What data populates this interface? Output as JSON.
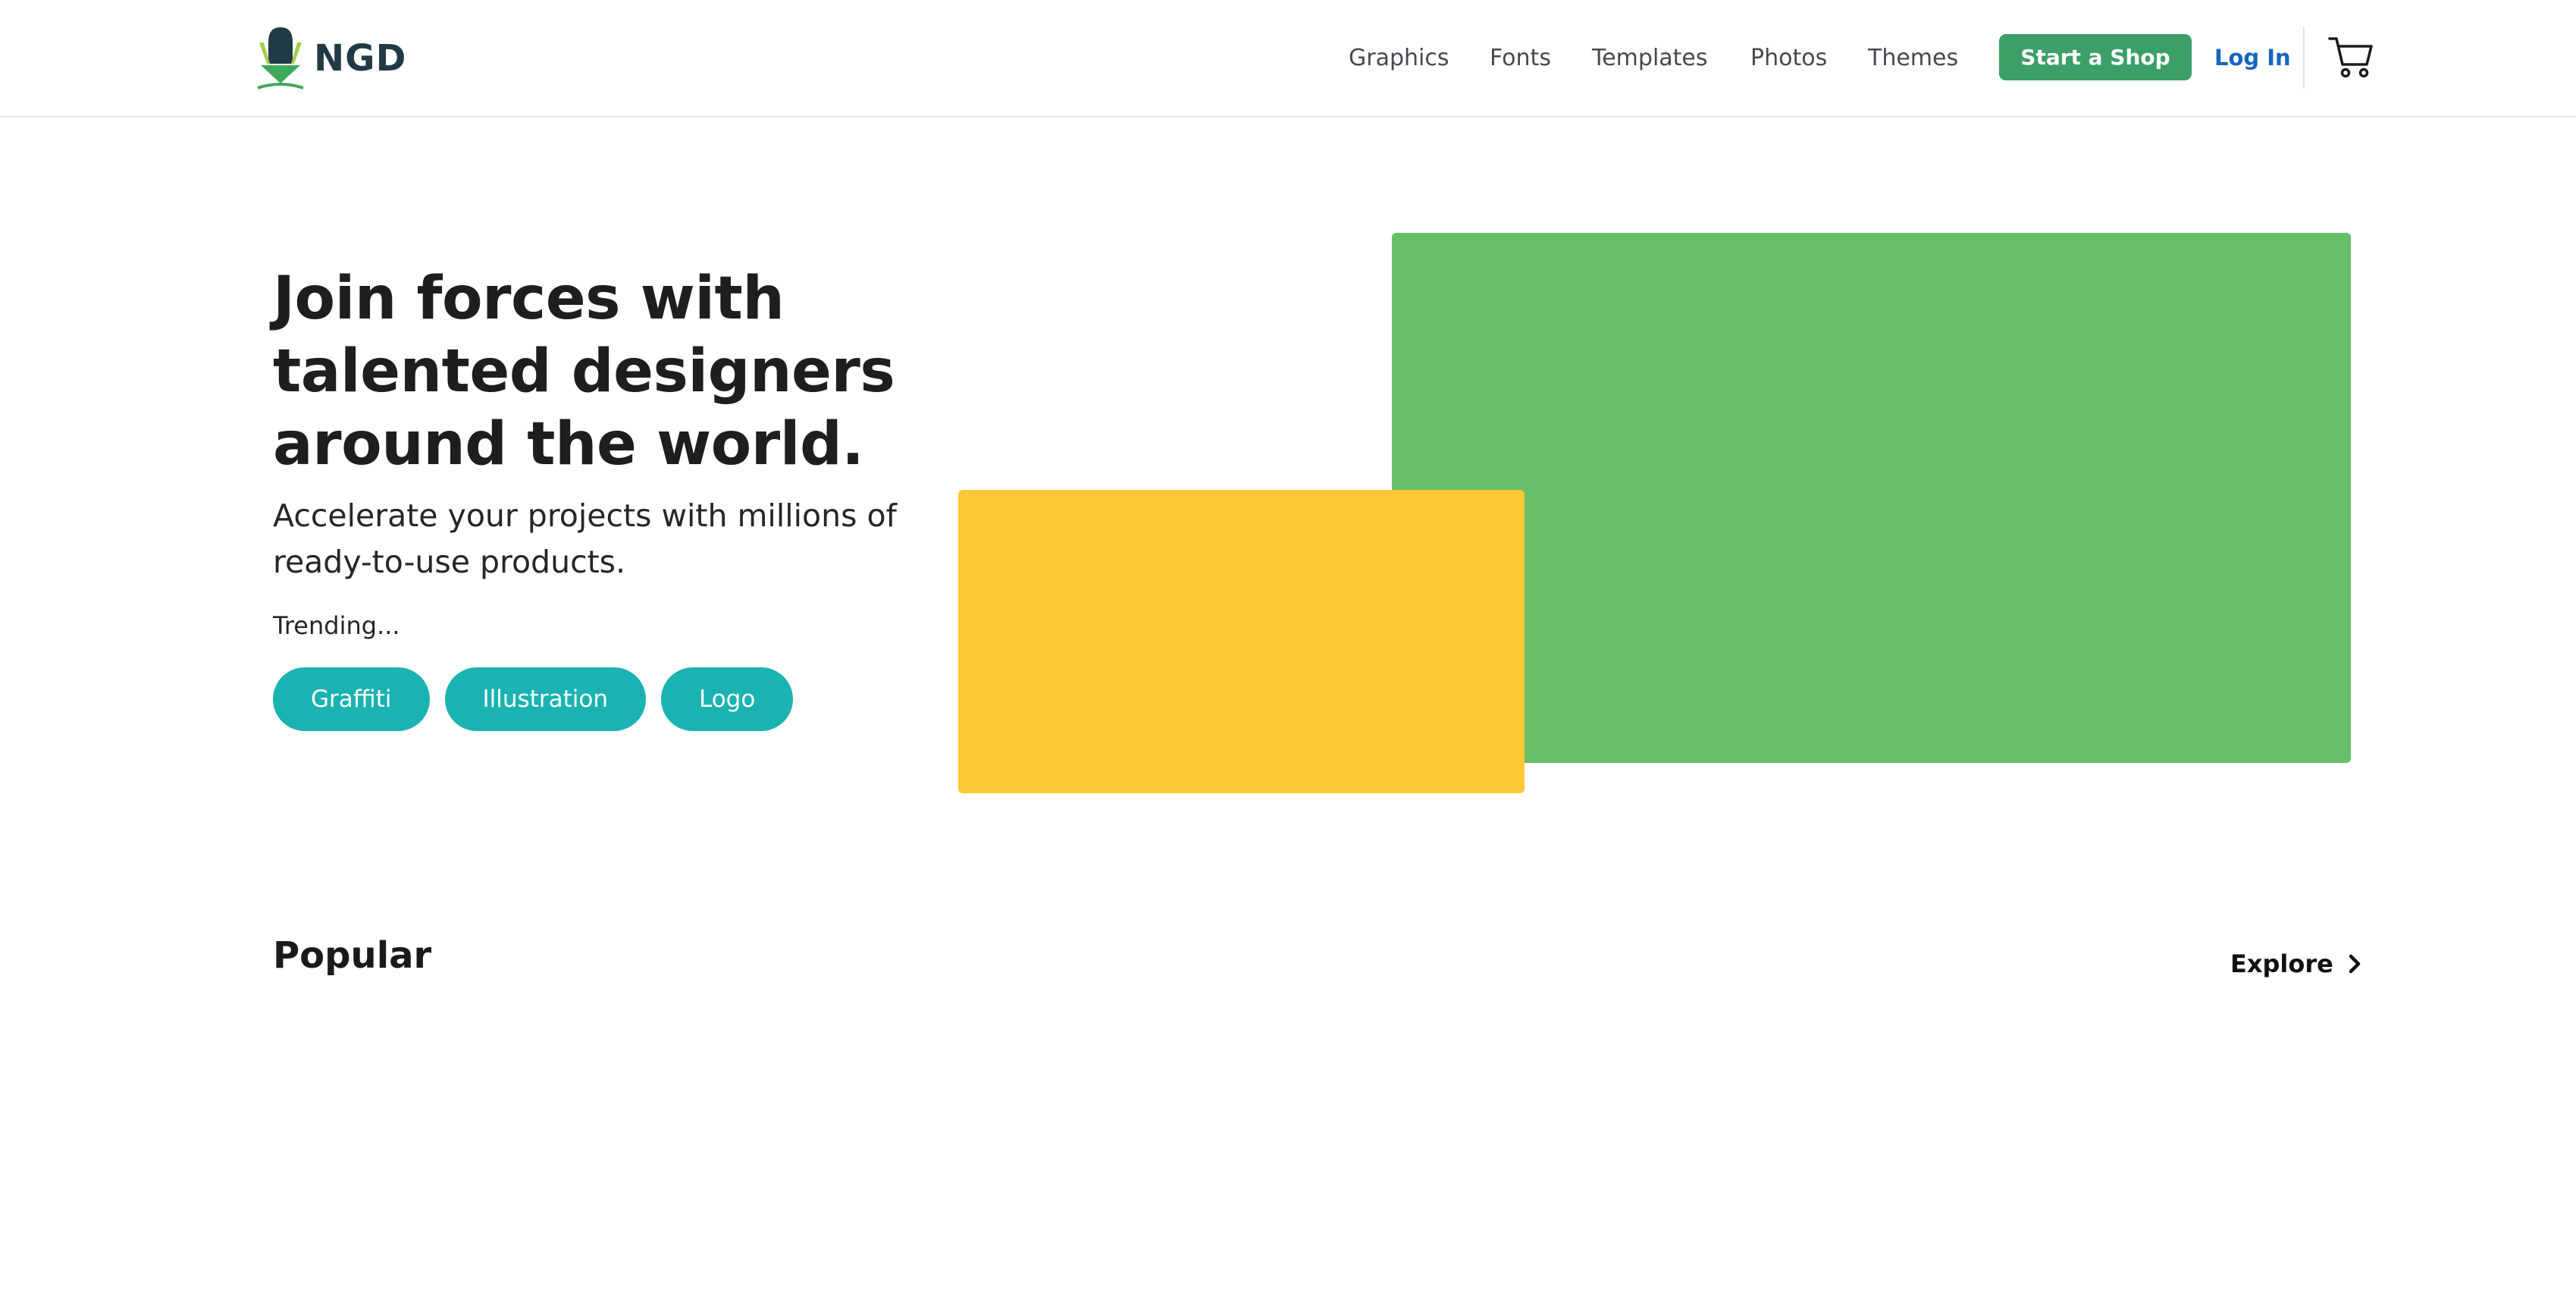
{
  "header": {
    "logo_text": "NGD",
    "nav": [
      {
        "label": "Graphics"
      },
      {
        "label": "Fonts"
      },
      {
        "label": "Templates"
      },
      {
        "label": "Photos"
      },
      {
        "label": "Themes"
      }
    ],
    "start_shop_label": "Start a Shop",
    "login_label": "Log In",
    "cart_icon": "shopping-cart-icon"
  },
  "hero": {
    "title": "Join forces with talented designers around the world.",
    "subtitle": "Accelerate your projects with millions of ready-to-use products.",
    "trending_label": "Trending...",
    "tags": [
      {
        "label": "Graffiti"
      },
      {
        "label": "Illustration"
      },
      {
        "label": "Logo"
      }
    ],
    "images": [
      {
        "name": "green-featured-image",
        "color": "#68bf68"
      },
      {
        "name": "yellow-featured-image",
        "color": "#fec836"
      }
    ]
  },
  "popular": {
    "title": "Popular",
    "explore_label": "Explore",
    "explore_icon": "chevron-right-icon"
  },
  "colors": {
    "brand_green": "#3c9f68",
    "link_blue": "#1565c0",
    "tag_teal": "#1bb2b2",
    "logo_navy": "#1f3a45"
  }
}
